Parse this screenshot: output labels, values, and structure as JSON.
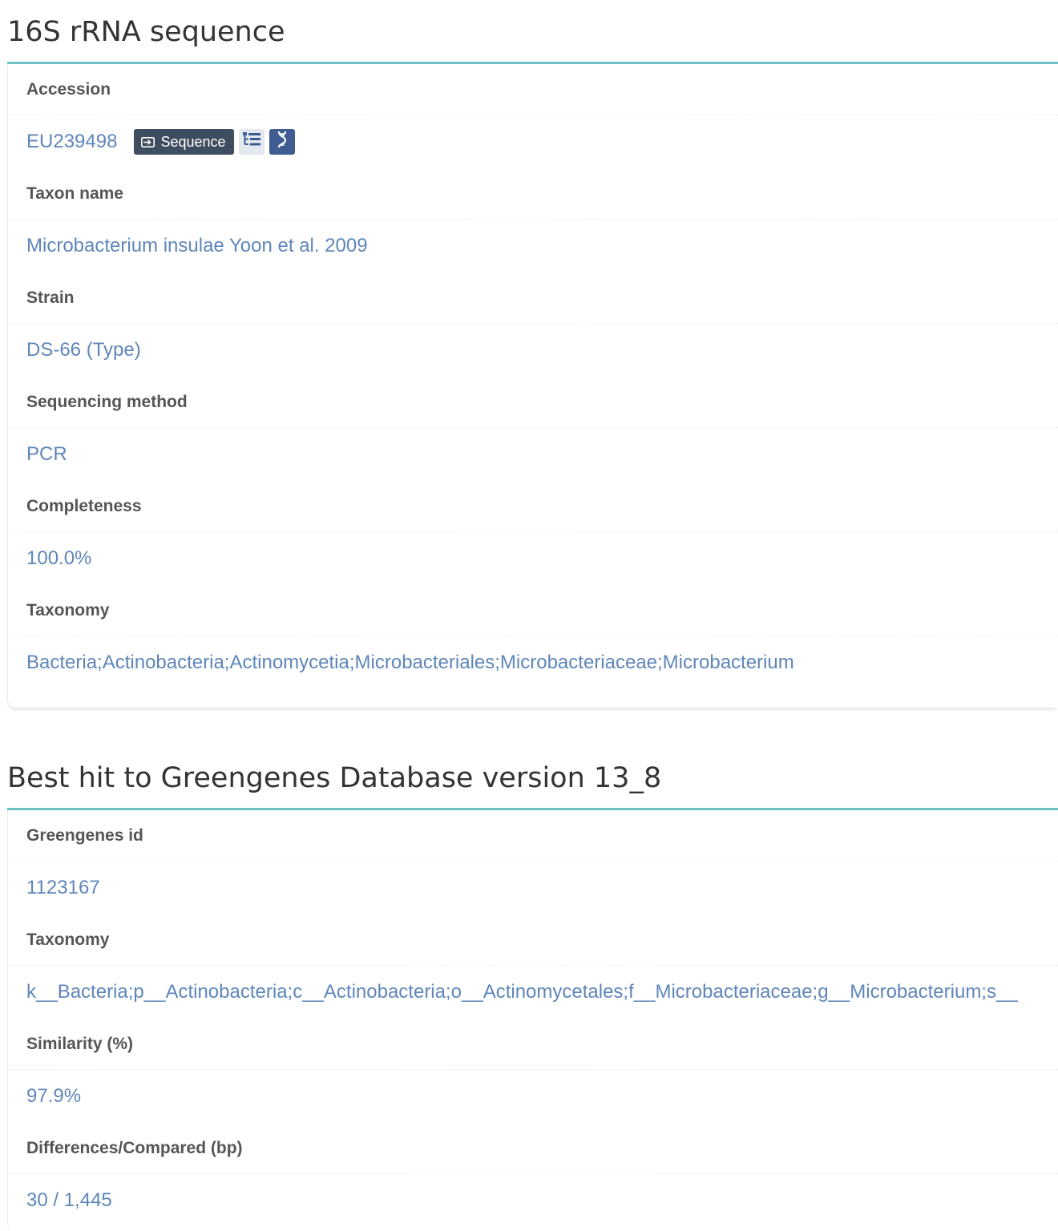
{
  "rrna": {
    "title": "16S rRNA sequence",
    "accession_label": "Accession",
    "accession_value": "EU239498",
    "sequence_button": "Sequence",
    "tree_icon": "tree-list-icon",
    "dna_icon": "dna-helix-icon",
    "taxon_label": "Taxon name",
    "taxon_value": "Microbacterium insulae Yoon et al. 2009",
    "strain_label": "Strain",
    "strain_value": "DS-66 (Type)",
    "method_label": "Sequencing method",
    "method_value": "PCR",
    "completeness_label": "Completeness",
    "completeness_value": "100.0%",
    "taxonomy_label": "Taxonomy",
    "taxonomy_value": "Bacteria;Actinobacteria;Actinomycetia;Microbacteriales;Microbacteriaceae;Microbacterium"
  },
  "greengenes": {
    "title": "Best hit to Greengenes Database version 13_8",
    "id_label": "Greengenes id",
    "id_value": "1123167",
    "taxonomy_label": "Taxonomy",
    "taxonomy_value": "k__Bacteria;p__Actinobacteria;c__Actinobacteria;o__Actinomycetales;f__Microbacteriaceae;g__Microbacterium;s__",
    "similarity_label": "Similarity (%)",
    "similarity_value": "97.9%",
    "diff_label": "Differences/Compared (bp)",
    "diff_value": "30 / 1,445"
  },
  "colors": {
    "accent_rule": "#6bc2c2",
    "link": "#5f86ba",
    "label": "#555555",
    "sequence_button_bg": "#3e4d5f",
    "dna_button_bg": "#3f5d92"
  }
}
